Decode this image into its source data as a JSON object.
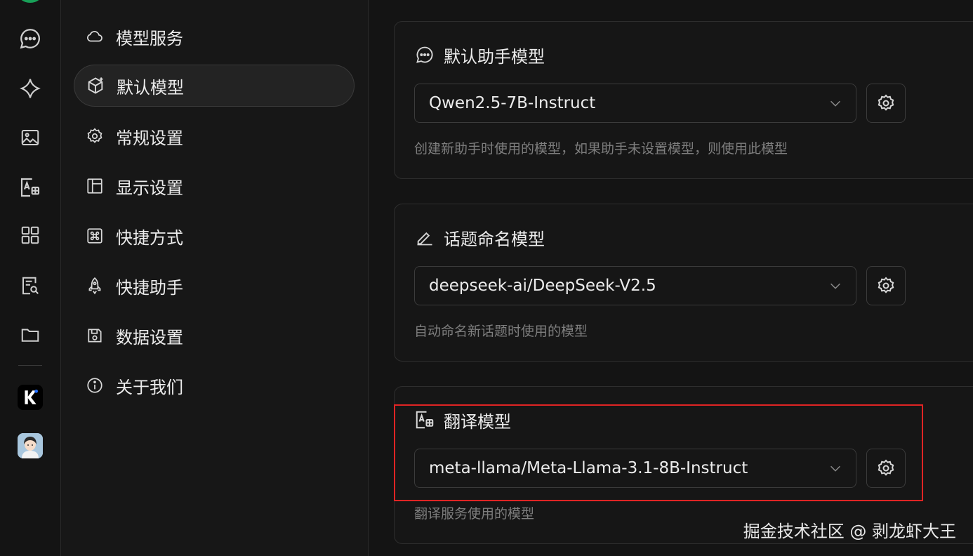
{
  "rail": {
    "icons": [
      "chat-icon",
      "sparkle-icon",
      "image-icon",
      "translate-icon",
      "apps-icon",
      "doc-search-icon",
      "folder-icon"
    ]
  },
  "menu": {
    "items": [
      {
        "label": "模型服务",
        "icon": "cloud-icon",
        "active": false
      },
      {
        "label": "默认模型",
        "icon": "cube-icon",
        "active": true
      },
      {
        "label": "常规设置",
        "icon": "gear-icon",
        "active": false
      },
      {
        "label": "显示设置",
        "icon": "layout-icon",
        "active": false
      },
      {
        "label": "快捷方式",
        "icon": "command-icon",
        "active": false
      },
      {
        "label": "快捷助手",
        "icon": "rocket-icon",
        "active": false
      },
      {
        "label": "数据设置",
        "icon": "save-icon",
        "active": false
      },
      {
        "label": "关于我们",
        "icon": "info-icon",
        "active": false
      }
    ]
  },
  "cards": [
    {
      "title": "默认助手模型",
      "icon": "chat-icon",
      "value": "Qwen2.5-7B-Instruct",
      "description": "创建新助手时使用的模型，如果助手未设置模型，则使用此模型"
    },
    {
      "title": "话题命名模型",
      "icon": "edit-icon",
      "value": "deepseek-ai/DeepSeek-V2.5",
      "description": "自动命名新话题时使用的模型"
    },
    {
      "title": "翻译模型",
      "icon": "translate-icon",
      "value": "meta-llama/Meta-Llama-3.1-8B-Instruct",
      "description": "翻译服务使用的模型"
    }
  ],
  "watermark": "掘金技术社区 @ 剥龙虾大王",
  "colors": {
    "background": "#141414",
    "highlight": "#e02424",
    "text": "#ececec",
    "muted": "#7e7e7e"
  }
}
